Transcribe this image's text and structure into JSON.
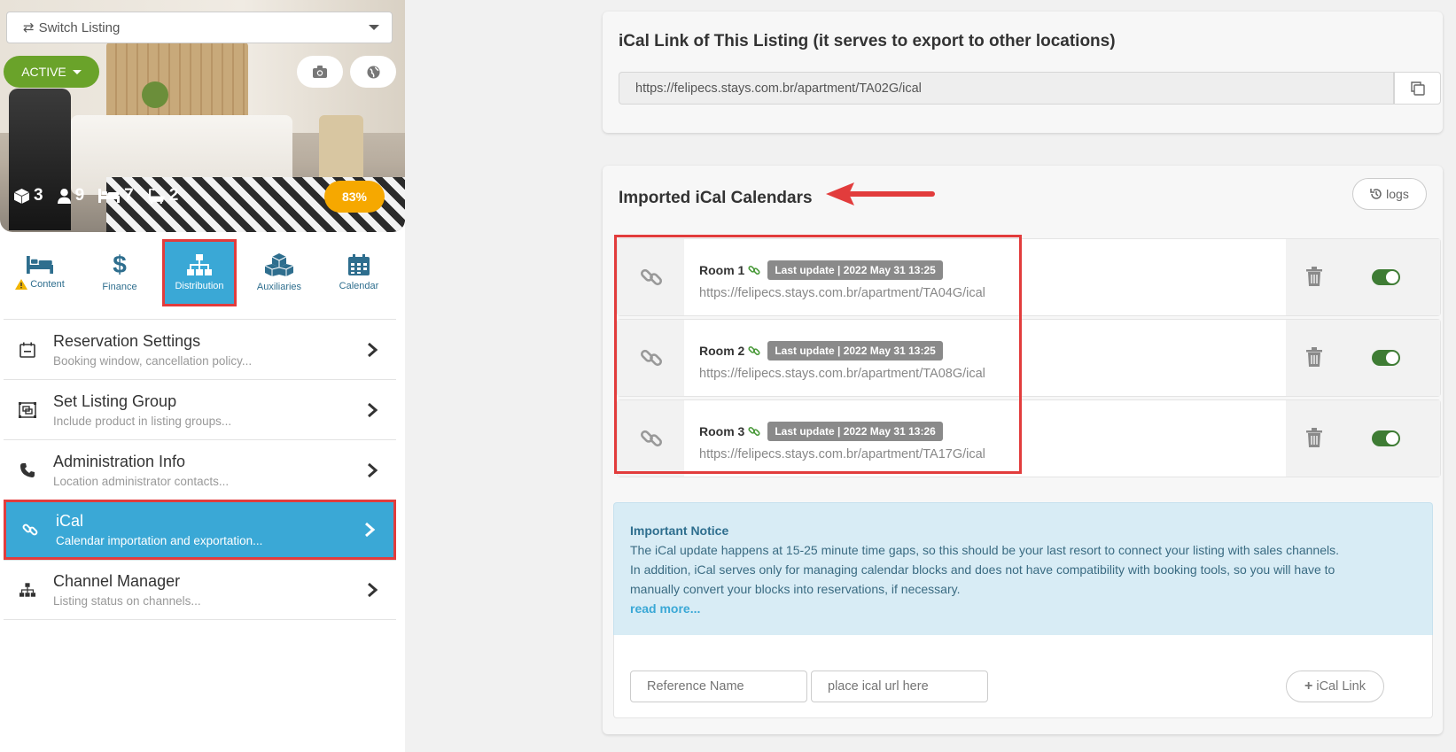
{
  "sidebar": {
    "switch_listing": "Switch Listing",
    "status_button": "ACTIVE",
    "stats": {
      "rooms": "3",
      "guests": "9",
      "beds": "7",
      "baths": "2"
    },
    "progress": "83%",
    "progress_value": 83,
    "tabs": [
      {
        "label": "Content",
        "warning": true
      },
      {
        "label": "Finance"
      },
      {
        "label": "Distribution",
        "active": true
      },
      {
        "label": "Auxiliaries"
      },
      {
        "label": "Calendar"
      }
    ],
    "menu": [
      {
        "title": "Reservation Settings",
        "subtitle": "Booking window, cancellation policy..."
      },
      {
        "title": "Set Listing Group",
        "subtitle": "Include product in listing groups..."
      },
      {
        "title": "Administration Info",
        "subtitle": "Location administrator contacts..."
      },
      {
        "title": "iCal",
        "subtitle": "Calendar importation and exportation...",
        "active": true
      },
      {
        "title": "Channel Manager",
        "subtitle": "Listing status on channels..."
      }
    ]
  },
  "export": {
    "title": "iCal Link of This Listing (it serves to export to other locations)",
    "url": "https://felipecs.stays.com.br/apartment/TA02G/ical"
  },
  "imported": {
    "title": "Imported iCal Calendars",
    "logs_label": "logs",
    "calendars": [
      {
        "name": "Room 1",
        "badge": "Last update | 2022 May 31 13:25",
        "url": "https://felipecs.stays.com.br/apartment/TA04G/ical",
        "enabled": true
      },
      {
        "name": "Room 2",
        "badge": "Last update | 2022 May 31 13:25",
        "url": "https://felipecs.stays.com.br/apartment/TA08G/ical",
        "enabled": true
      },
      {
        "name": "Room 3",
        "badge": "Last update | 2022 May 31 13:26",
        "url": "https://felipecs.stays.com.br/apartment/TA17G/ical",
        "enabled": true
      }
    ]
  },
  "notice": {
    "title": "Important Notice",
    "line1": "The iCal update happens at 15-25 minute time gaps, so this should be your last resort to connect your listing with sales channels.",
    "line2": "In addition, iCal serves only for managing calendar blocks and does not have compatibility with booking tools, so you will have to",
    "line3": "manually convert your blocks into reservations, if necessary.",
    "read_more": "read more..."
  },
  "add_form": {
    "reference_placeholder": "Reference Name",
    "url_placeholder": "place ical url here",
    "add_button": "iCal Link"
  },
  "colors": {
    "accent": "#3aa8d6",
    "active_green": "#6aa32a",
    "badge_orange": "#f6a800",
    "highlight_red": "#e23c3c",
    "toggle_green": "#3e7c34"
  }
}
